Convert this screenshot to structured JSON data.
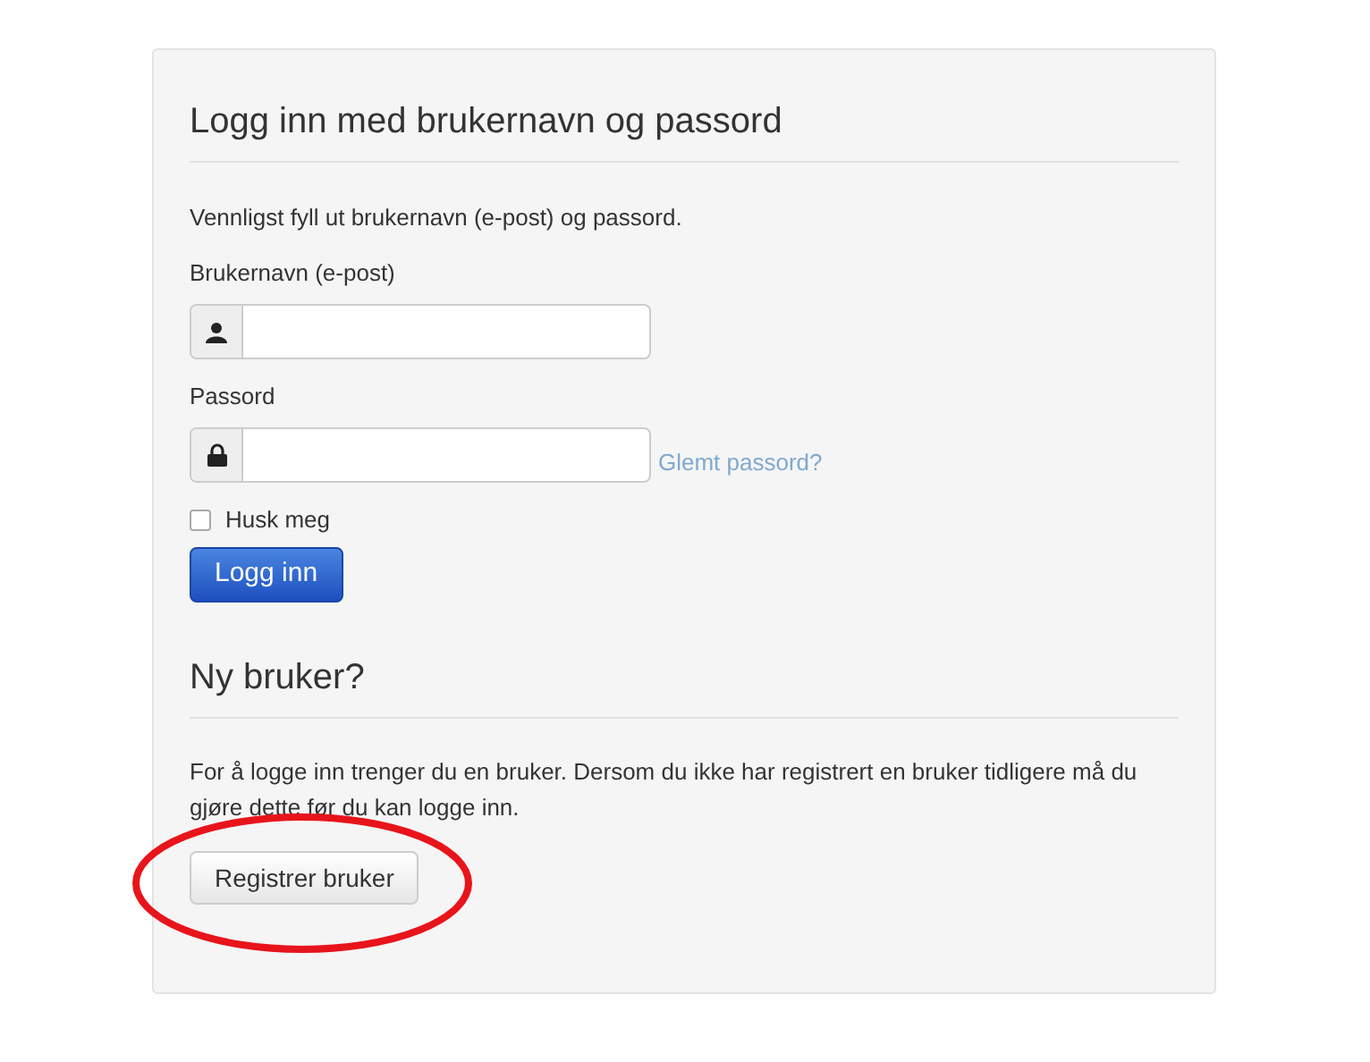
{
  "login": {
    "title": "Logg inn med brukernavn og passord",
    "intro": "Vennligst fyll ut brukernavn (e-post) og passord.",
    "username_label": "Brukernavn (e-post)",
    "password_label": "Passord",
    "forgot_link": "Glemt passord?",
    "remember": {
      "label": "Husk meg",
      "checked": false
    },
    "submit": "Logg inn"
  },
  "register": {
    "title": "Ny bruker?",
    "text": "For å logge inn trenger du en bruker. Dersom du ikke har registrert en bruker tidligere må du gjøre dette før du kan logge inn.",
    "button": "Registrer bruker",
    "highlighted": true
  }
}
